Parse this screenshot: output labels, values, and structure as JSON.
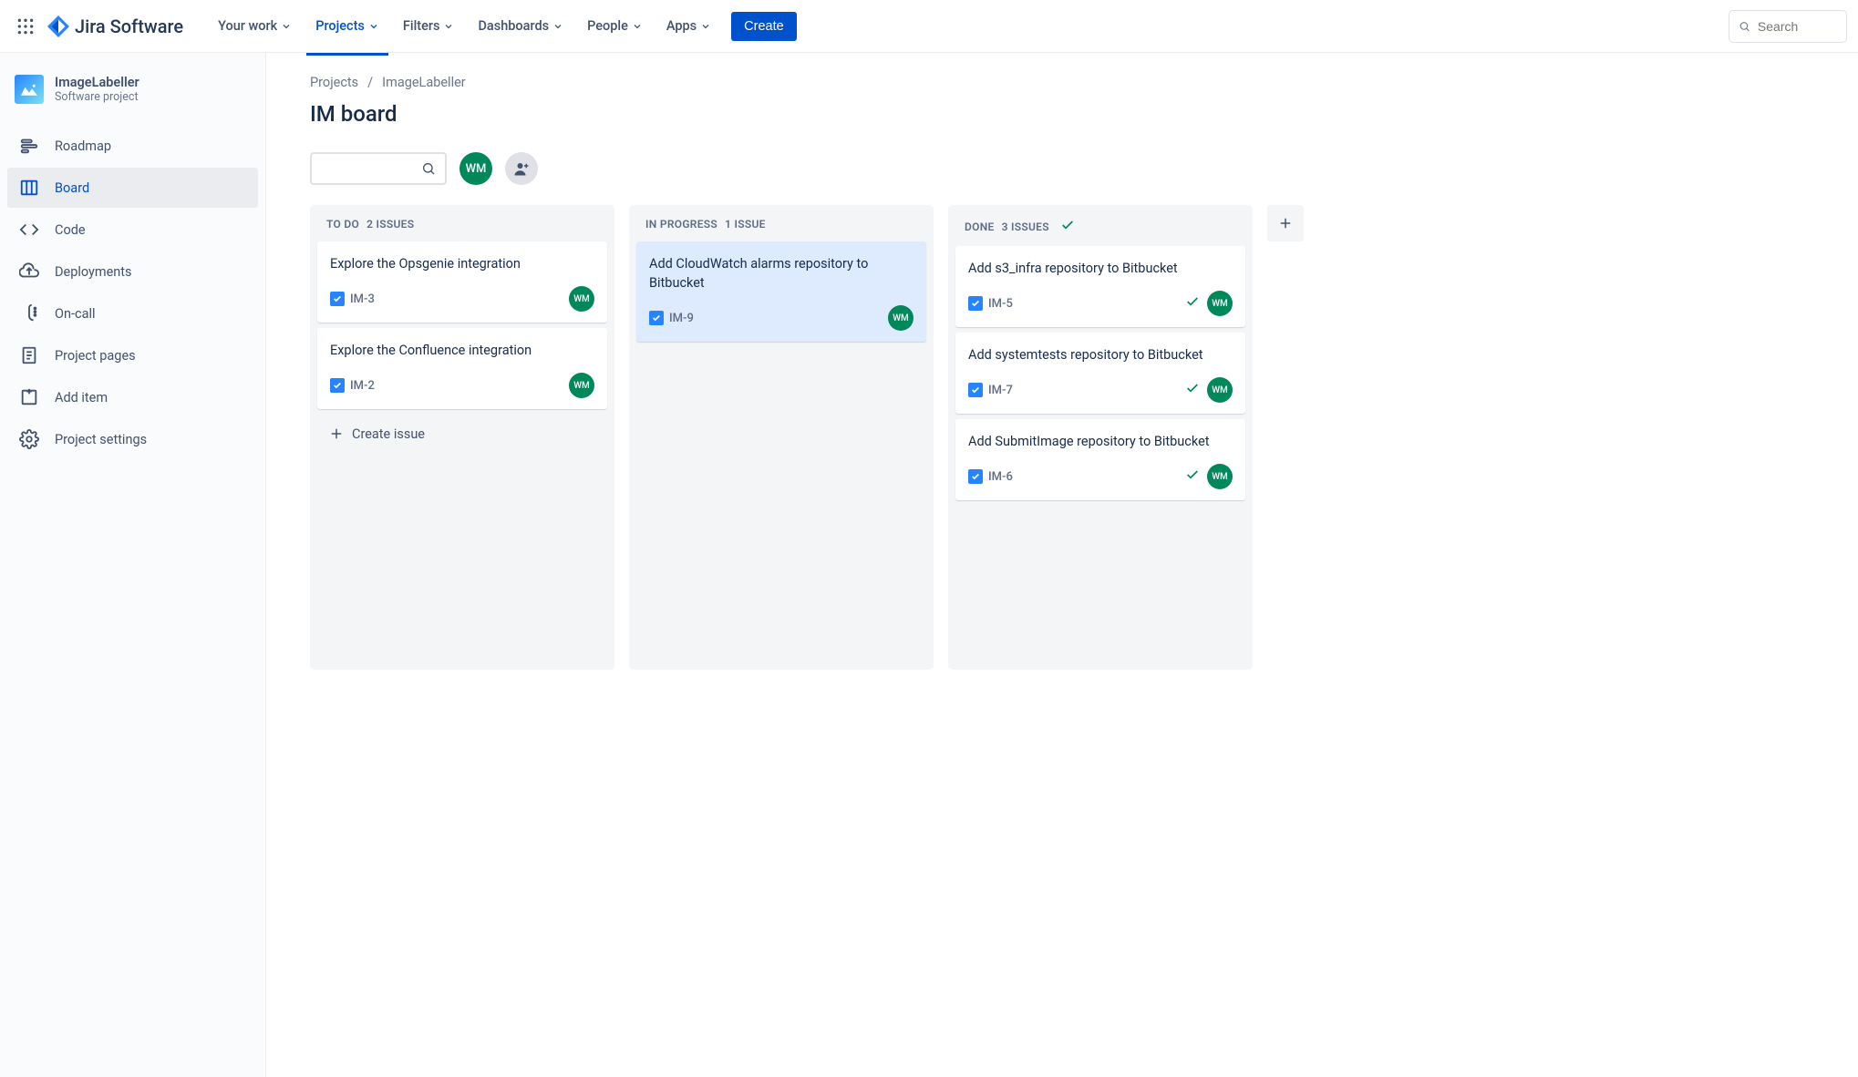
{
  "brand": {
    "name": "Jira Software"
  },
  "topnav": {
    "items": [
      {
        "label": "Your work",
        "active": false
      },
      {
        "label": "Projects",
        "active": true
      },
      {
        "label": "Filters",
        "active": false
      },
      {
        "label": "Dashboards",
        "active": false
      },
      {
        "label": "People",
        "active": false
      },
      {
        "label": "Apps",
        "active": false
      }
    ],
    "create": "Create",
    "search_placeholder": "Search"
  },
  "sidebar": {
    "project": {
      "name": "ImageLabeller",
      "subtitle": "Software project"
    },
    "items": [
      {
        "key": "roadmap",
        "label": "Roadmap",
        "icon": "roadmap-icon",
        "active": false
      },
      {
        "key": "board",
        "label": "Board",
        "icon": "board-icon",
        "active": true
      },
      {
        "key": "code",
        "label": "Code",
        "icon": "code-icon",
        "active": false
      },
      {
        "key": "deployments",
        "label": "Deployments",
        "icon": "deploy-icon",
        "active": false
      },
      {
        "key": "oncall",
        "label": "On-call",
        "icon": "oncall-icon",
        "active": false
      },
      {
        "key": "pages",
        "label": "Project pages",
        "icon": "pages-icon",
        "active": false
      },
      {
        "key": "additem",
        "label": "Add item",
        "icon": "add-icon",
        "active": false
      },
      {
        "key": "settings",
        "label": "Project settings",
        "icon": "settings-icon",
        "active": false
      }
    ]
  },
  "breadcrumbs": {
    "root": "Projects",
    "current": "ImageLabeller"
  },
  "page": {
    "title": "IM board"
  },
  "board_controls": {
    "avatar_initials": "WM"
  },
  "columns": [
    {
      "name": "To Do",
      "count_label": "2 issues",
      "done_check": false,
      "cards": [
        {
          "title": "Explore the Opsgenie integration",
          "key": "IM-3",
          "assignee": "WM",
          "done": false,
          "selected": false
        },
        {
          "title": "Explore the Confluence integration",
          "key": "IM-2",
          "assignee": "WM",
          "done": false,
          "selected": false
        }
      ],
      "create_label": "Create issue"
    },
    {
      "name": "In Progress",
      "count_label": "1 issue",
      "done_check": false,
      "cards": [
        {
          "title": "Add CloudWatch alarms repository to Bitbucket",
          "key": "IM-9",
          "assignee": "WM",
          "done": false,
          "selected": true
        }
      ]
    },
    {
      "name": "Done",
      "count_label": "3 issues",
      "done_check": true,
      "cards": [
        {
          "title": "Add s3_infra repository to Bitbucket",
          "key": "IM-5",
          "assignee": "WM",
          "done": true,
          "selected": false
        },
        {
          "title": "Add systemtests repository to Bitbucket",
          "key": "IM-7",
          "assignee": "WM",
          "done": true,
          "selected": false
        },
        {
          "title": "Add SubmitImage repository to Bitbucket",
          "key": "IM-6",
          "assignee": "WM",
          "done": true,
          "selected": false
        }
      ]
    }
  ]
}
